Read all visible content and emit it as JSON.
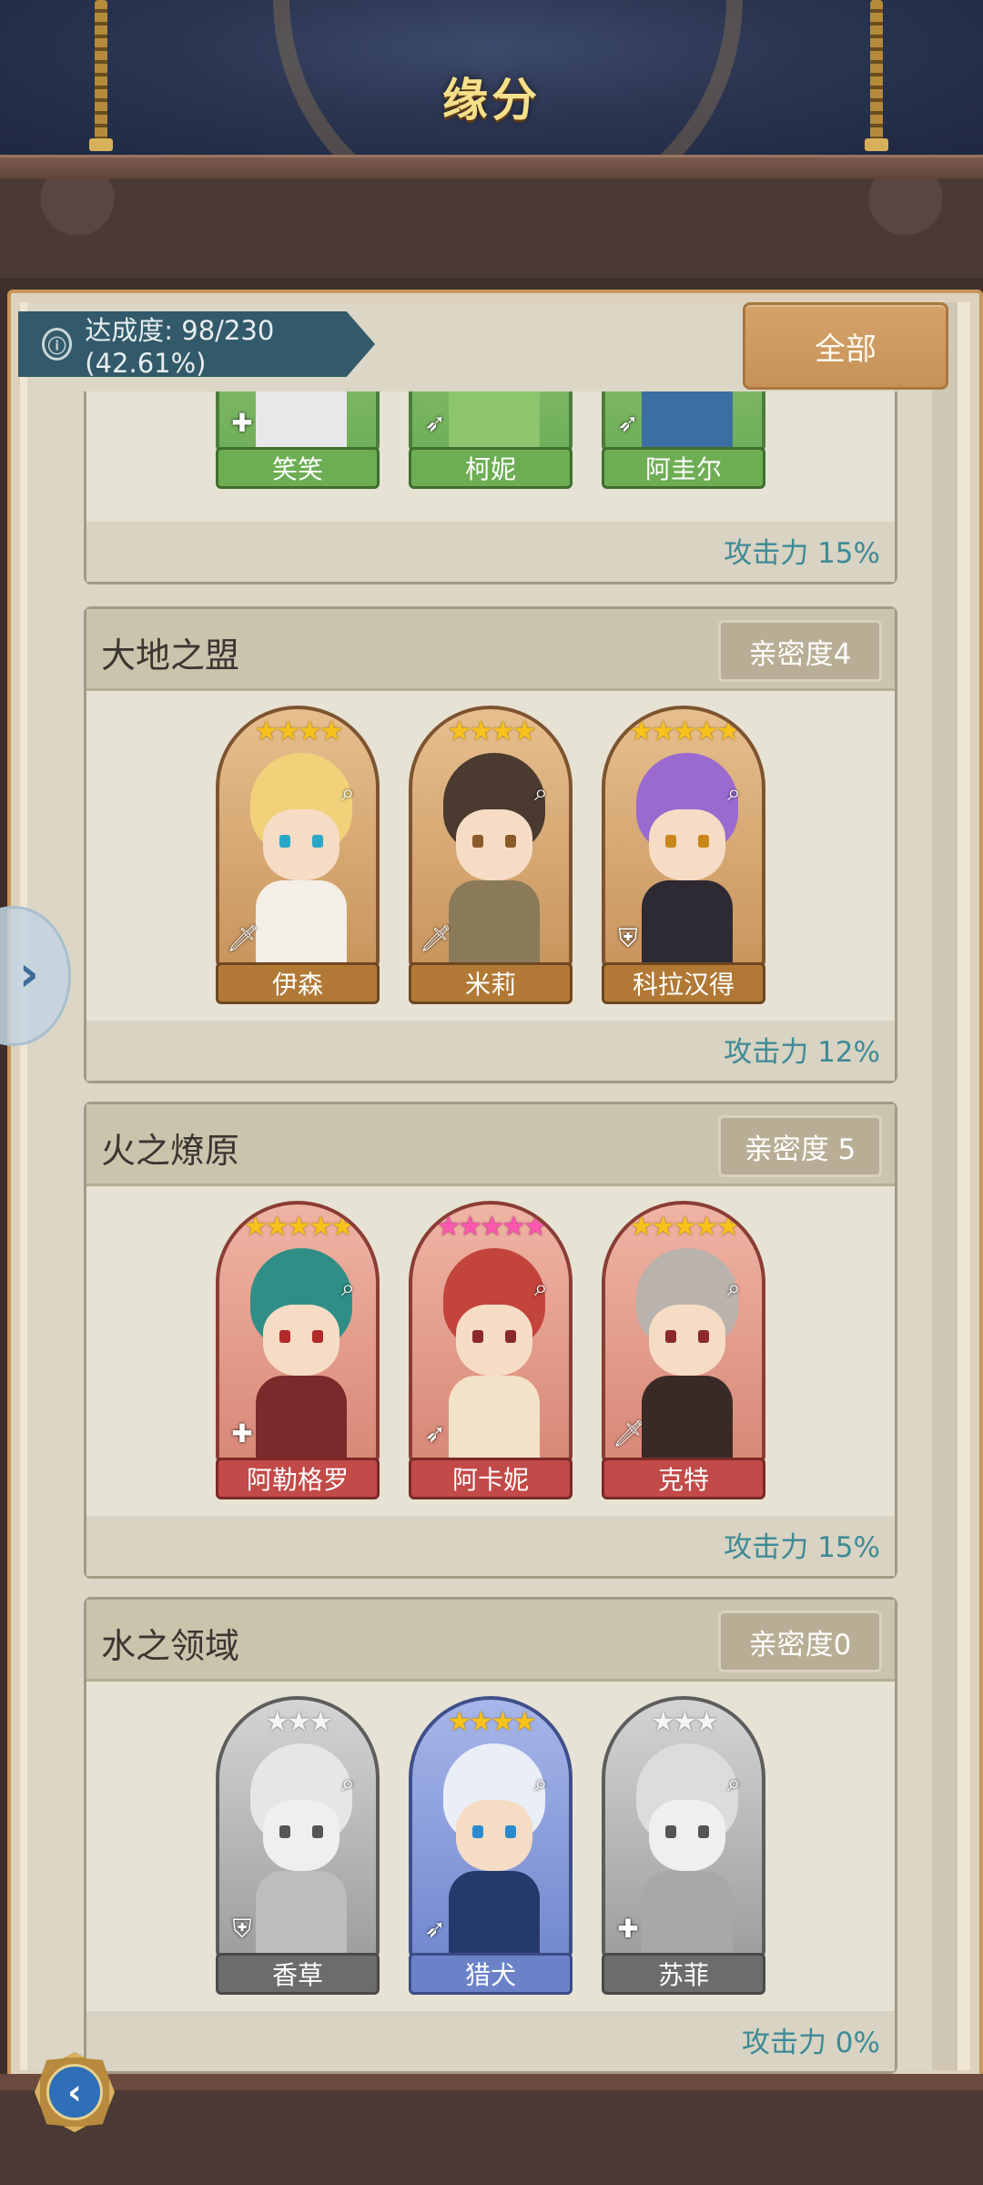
{
  "header": {
    "title": "缘分"
  },
  "achievement": {
    "label": "达成度: 98/230 (42.61%)"
  },
  "filter": {
    "label": "全部"
  },
  "groups": [
    {
      "name": "",
      "intimacy": "",
      "bonus": "攻击力 15%",
      "heroes": [
        {
          "name": "笑笑",
          "rarity": "green",
          "class_icon": "cross-icon"
        },
        {
          "name": "柯妮",
          "rarity": "green",
          "class_icon": "bow-icon"
        },
        {
          "name": "阿圭尔",
          "rarity": "green",
          "class_icon": "bow-icon"
        }
      ]
    },
    {
      "name": "大地之盟",
      "intimacy": "亲密度4",
      "bonus": "攻击力 12%",
      "heroes": [
        {
          "name": "伊森",
          "rarity": "gold",
          "stars": "★★★★",
          "class_icon": "sword-icon"
        },
        {
          "name": "米莉",
          "rarity": "gold",
          "stars": "★★★★",
          "class_icon": "sword-icon"
        },
        {
          "name": "科拉汉得",
          "rarity": "gold",
          "stars": "★★★★★",
          "class_icon": "shield-icon"
        }
      ]
    },
    {
      "name": "火之燎原",
      "intimacy": "亲密度 5",
      "bonus": "攻击力 15%",
      "heroes": [
        {
          "name": "阿勒格罗",
          "rarity": "red",
          "stars": "★★★★★",
          "class_icon": "cross-icon"
        },
        {
          "name": "阿卡妮",
          "rarity": "red",
          "stars": "★★★★★",
          "class_icon": "bow-icon"
        },
        {
          "name": "克特",
          "rarity": "red",
          "stars": "★★★★★",
          "class_icon": "sword-icon"
        }
      ]
    },
    {
      "name": "水之领域",
      "intimacy": "亲密度0",
      "bonus": "攻击力 0%",
      "heroes": [
        {
          "name": "香草",
          "rarity": "grey",
          "stars": "★★★",
          "class_icon": "shield-icon"
        },
        {
          "name": "猎犬",
          "rarity": "blue",
          "stars": "★★★★",
          "class_icon": "bow-icon"
        },
        {
          "name": "苏菲",
          "rarity": "grey",
          "stars": "★★★",
          "class_icon": "cross-icon"
        }
      ]
    }
  ],
  "icons": {
    "info": "ⓘ",
    "search": "⌕",
    "expand": "›",
    "back": "‹"
  }
}
